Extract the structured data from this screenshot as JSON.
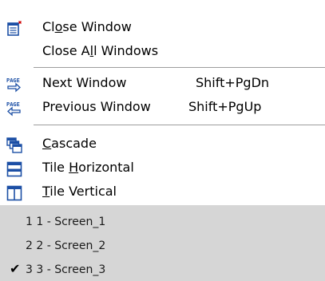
{
  "menu": {
    "close_window": {
      "pre": "Cl",
      "accel": "o",
      "post": "se Window",
      "icon": "close-window-icon"
    },
    "close_all_windows": {
      "pre": "Close A",
      "accel": "l",
      "post": "l Windows"
    },
    "next_window": {
      "label": "Next Window",
      "shortcut": "Shift+PgDn",
      "icon": "next-page-icon",
      "icon_text": "PAGE"
    },
    "previous_window": {
      "label": "Previous Window",
      "shortcut": "Shift+PgUp",
      "icon": "previous-page-icon",
      "icon_text": "PAGE"
    },
    "cascade": {
      "pre": "",
      "accel": "C",
      "post": "ascade",
      "icon": "cascade-icon"
    },
    "tile_horizontal": {
      "pre": "Tile ",
      "accel": "H",
      "post": "orizontal",
      "icon": "tile-horizontal-icon"
    },
    "tile_vertical": {
      "pre": "",
      "accel": "T",
      "post": "ile Vertical",
      "icon": "tile-vertical-icon"
    }
  },
  "windows": [
    {
      "label": "1 1 - Screen_1",
      "checked": false
    },
    {
      "label": "2 2 - Screen_2",
      "checked": false
    },
    {
      "label": "3 3 - Screen_3",
      "checked": true
    }
  ],
  "check_mark": "✔",
  "colors": {
    "icon_blue": "#1c4fa5",
    "lower_panel": "#d6d6d6",
    "separator": "#9d9d9d"
  }
}
